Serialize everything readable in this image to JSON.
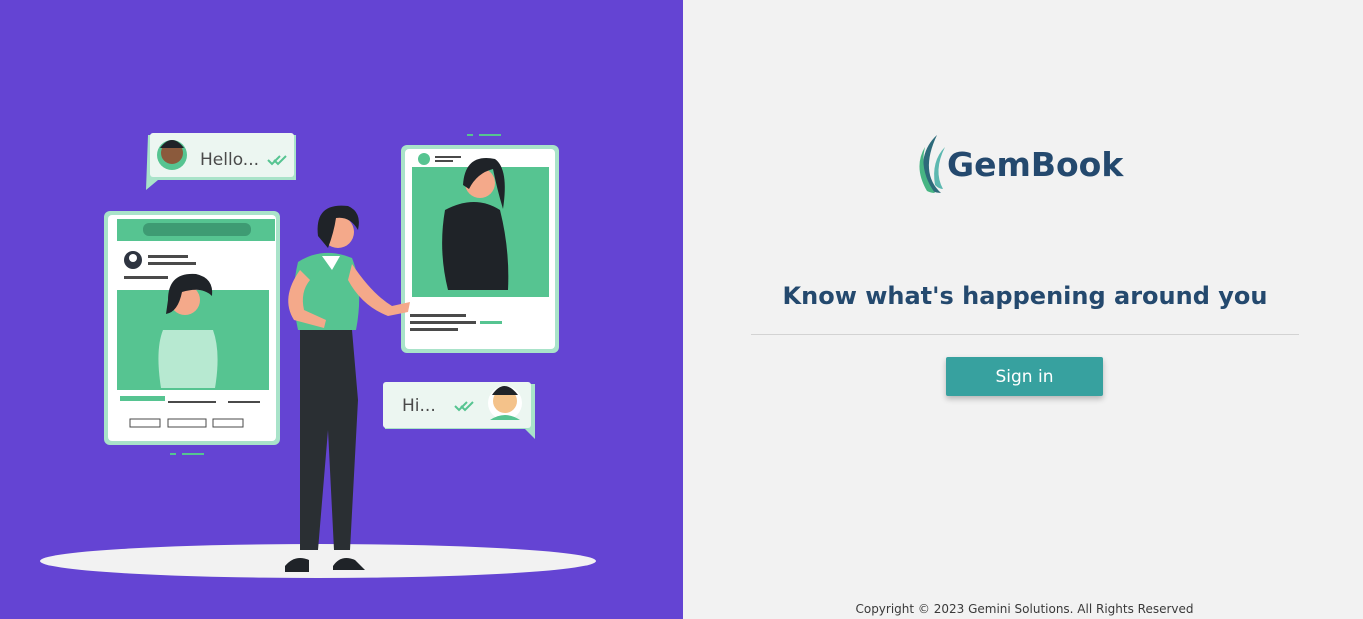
{
  "brand": {
    "name": "GemBook",
    "colors": {
      "primary": "#24496e",
      "accent": "#37a19f",
      "panel": "#6444d3",
      "leaf_green": "#47b583",
      "leaf_teal": "#2d6a7a"
    }
  },
  "illustration": {
    "bubble_hello": "Hello...",
    "bubble_hi": "Hi..."
  },
  "main": {
    "tagline": "Know what's happening around you",
    "signin_label": "Sign in"
  },
  "footer": {
    "copyright": "Copyright © 2023 Gemini Solutions. All Rights Reserved"
  }
}
